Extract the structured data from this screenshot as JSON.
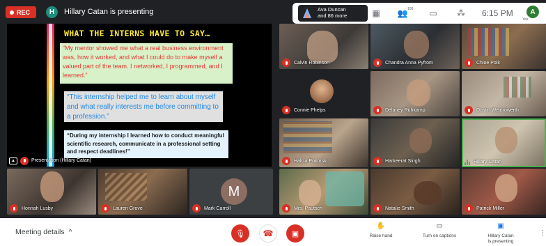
{
  "topbar": {
    "rec_label": "REC",
    "presenter_initial": "H",
    "presenting_text": "Hillary Catan is presenting",
    "participants_info": {
      "name": "Ava Duncan",
      "more": "and 86 more"
    },
    "participant_count": "100",
    "clock": "6:15 PM",
    "me_initial": "A",
    "you_label": "You"
  },
  "presentation": {
    "title": "WHAT THE INTERNS HAVE TO SAY…",
    "quote1": "“My mentor showed me what a real business environment was, how it worked, and what I could do to make myself a valued part of the team. I networked, I programmed, and I learned.”",
    "quote2": "“This internship helped me to learn about myself and what really interests me before committing to a profession.”",
    "quote3": "“During my internship I learned how to conduct meaningful scientific research, communicate in a professional setting and respect deadlines!”",
    "label": "Presentation (Hillary Catan)"
  },
  "tiles": [
    {
      "name": "Calvin Robinson"
    },
    {
      "name": "Chandra Anna Pyfrom"
    },
    {
      "name": "Chloe Polk"
    },
    {
      "name": "Connie Phelps"
    },
    {
      "name": "Delaney Ruhkamp"
    },
    {
      "name": "Dustin Weinrowerth"
    },
    {
      "name": "Halcia Pokorski"
    },
    {
      "name": "Harkeerat Singh"
    },
    {
      "name": "Hillary Catan"
    },
    {
      "name": "Honnah Lusby"
    },
    {
      "name": "Lauren Grove"
    },
    {
      "name": "Mark Carroll",
      "initial": "M"
    },
    {
      "name": "Mrs. Pautsch"
    },
    {
      "name": "Natalie Smith"
    },
    {
      "name": "Patrick Miller"
    }
  ],
  "bottombar": {
    "meeting_details": "Meeting details",
    "raise_hand": "Raise hand",
    "captions": "Turn on captions",
    "presenting_line1": "Hillary Catan",
    "presenting_line2": "is presenting"
  },
  "colors": {
    "red": "#d93025",
    "dark_bg": "#202124",
    "active_green": "#4caf50"
  }
}
